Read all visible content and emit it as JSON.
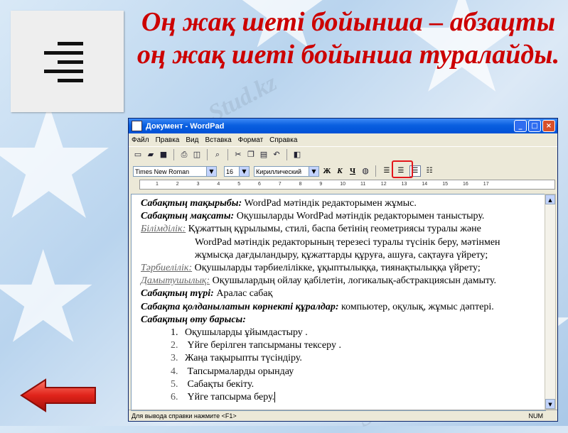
{
  "slide": {
    "title": "Оң жақ шеті бойынша – абзацты оң жақ шеті бойынша туралайды."
  },
  "window": {
    "title": "Документ - WordPad",
    "menu": [
      "Файл",
      "Правка",
      "Вид",
      "Вставка",
      "Формат",
      "Справка"
    ],
    "font_name": "Times New Roman",
    "font_size": "16",
    "script": "Кириллический",
    "format_buttons": [
      "Ж",
      "К",
      "Ч"
    ],
    "status": "Для вывода справки нажмите <F1>",
    "status_num": "NUM",
    "ruler_ticks": [
      "1",
      "2",
      "3",
      "4",
      "5",
      "6",
      "7",
      "8",
      "9",
      "10",
      "11",
      "12",
      "13",
      "14",
      "15",
      "16",
      "17"
    ]
  },
  "document": {
    "topic_label": "Сабақтың тақырыбы:",
    "topic_text": " WordPad мәтіндік редакторымен жұмыс.",
    "goal_label": "Сабақтың мақсаты:",
    "goal_text": " Оқушыларды WordPad мәтіндік редакторымен таныстыру.",
    "edu_label": "Білімділік:",
    "edu_line1": "  Құжаттың құрылымы, стилі, баспа бетінің геометриясы туралы және",
    "edu_line2": "WordPad мәтіндік редакторының терезесі туралы түсінік беру, мәтінмен",
    "edu_line3": "жұмысқа дағдыландыру, құжаттарды құруға, ашуға, сақтауға үйрету;",
    "upbr_label": "Тәрбиелілік:",
    "upbr_text": " Оқушыларды тәрбиелілікке, ұқыптылыққа, тиянақтылыққа үйрету;",
    "dev_label": "Дамытушылық:",
    "dev_text": " Оқушылардың ойлау қабілетін, логикалық-абстракциясын дамыту.",
    "type_label": "Сабақтың түрі:",
    "type_text": " Аралас сабақ",
    "vis_label": "Сабақта қолданылатын көрнекті құралдар:",
    "vis_text": " компьютер, оқулық, жұмыс дәптері.",
    "course_label": "Сабақтың өту барысы:",
    "steps": [
      {
        "n": "1.",
        "text": "Оқушыларды ұйымдастыру ."
      },
      {
        "n": "2.",
        "text": "  Үйге берілген тапсырманы тексеру ."
      },
      {
        "n": "3.",
        "text": "Жаңа тақырыпты түсіндіру."
      },
      {
        "n": "4.",
        "text": "  Тапсырмаларды орындау"
      },
      {
        "n": "5.",
        "text": "  Сабақты бекіту."
      },
      {
        "n": "6.",
        "text": "  Үйге тапсырма беру."
      }
    ]
  },
  "watermark": "Stud.kz",
  "colors": {
    "title": "#cc0000",
    "highlight": "#e3161b",
    "titlebar": "#0a5fe0"
  }
}
